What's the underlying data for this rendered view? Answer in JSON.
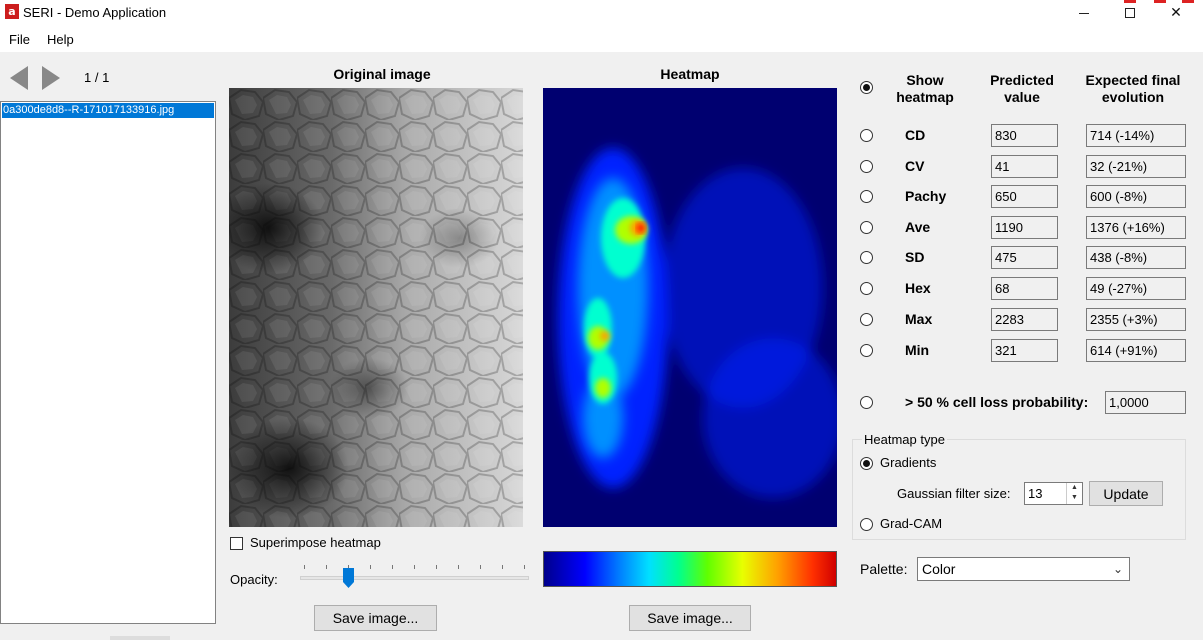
{
  "window": {
    "title": "SERI - Demo Application",
    "app_icon_text": "a"
  },
  "menu": {
    "file": "File",
    "help": "Help"
  },
  "nav": {
    "counter": "1 / 1"
  },
  "file_list": {
    "items": [
      "0a300de8d8--R-171017133916.jpg"
    ]
  },
  "panels": {
    "original_title": "Original image",
    "heatmap_title": "Heatmap",
    "superimpose_label": "Superimpose heatmap",
    "superimpose_checked": false,
    "opacity_label": "Opacity:",
    "opacity_value": 0.2,
    "save_image_label": "Save image...",
    "save_heatmap_label": "Save image..."
  },
  "table": {
    "header_show": "Show heatmap",
    "header_predicted": "Predicted value",
    "header_expected": "Expected final evolution",
    "rows": [
      {
        "label": "CD",
        "predicted": "830",
        "expected": "714 (-14%)"
      },
      {
        "label": "CV",
        "predicted": "41",
        "expected": "32 (-21%)"
      },
      {
        "label": "Pachy",
        "predicted": "650",
        "expected": "600 (-8%)"
      },
      {
        "label": "Ave",
        "predicted": "1190",
        "expected": "1376 (+16%)"
      },
      {
        "label": "SD",
        "predicted": "475",
        "expected": "438 (-8%)"
      },
      {
        "label": "Hex",
        "predicted": "68",
        "expected": "49 (-27%)"
      },
      {
        "label": "Max",
        "predicted": "2283",
        "expected": "2355 (+3%)"
      },
      {
        "label": "Min",
        "predicted": "321",
        "expected": "614 (+91%)"
      }
    ],
    "cell_loss_label": "> 50 % cell loss probability:",
    "cell_loss_value": "1,0000"
  },
  "heatmap_type": {
    "title": "Heatmap type",
    "gradients_label": "Gradients",
    "gaussian_label": "Gaussian filter size:",
    "gaussian_value": "13",
    "update_label": "Update",
    "gradcam_label": "Grad-CAM",
    "selected": "Gradients"
  },
  "palette": {
    "label": "Palette:",
    "selected": "Color"
  },
  "colors": {
    "selection": "#0078d7",
    "close_accent": "#d22222",
    "heat_bg": "#000070"
  },
  "icons": {
    "prev": "arrow-left-icon",
    "next": "arrow-right-icon",
    "minimize": "minimize-icon",
    "maximize": "maximize-icon",
    "close": "close-icon",
    "dropdown": "chevron-down-icon",
    "spin_up": "caret-up-icon",
    "spin_down": "caret-down-icon"
  }
}
